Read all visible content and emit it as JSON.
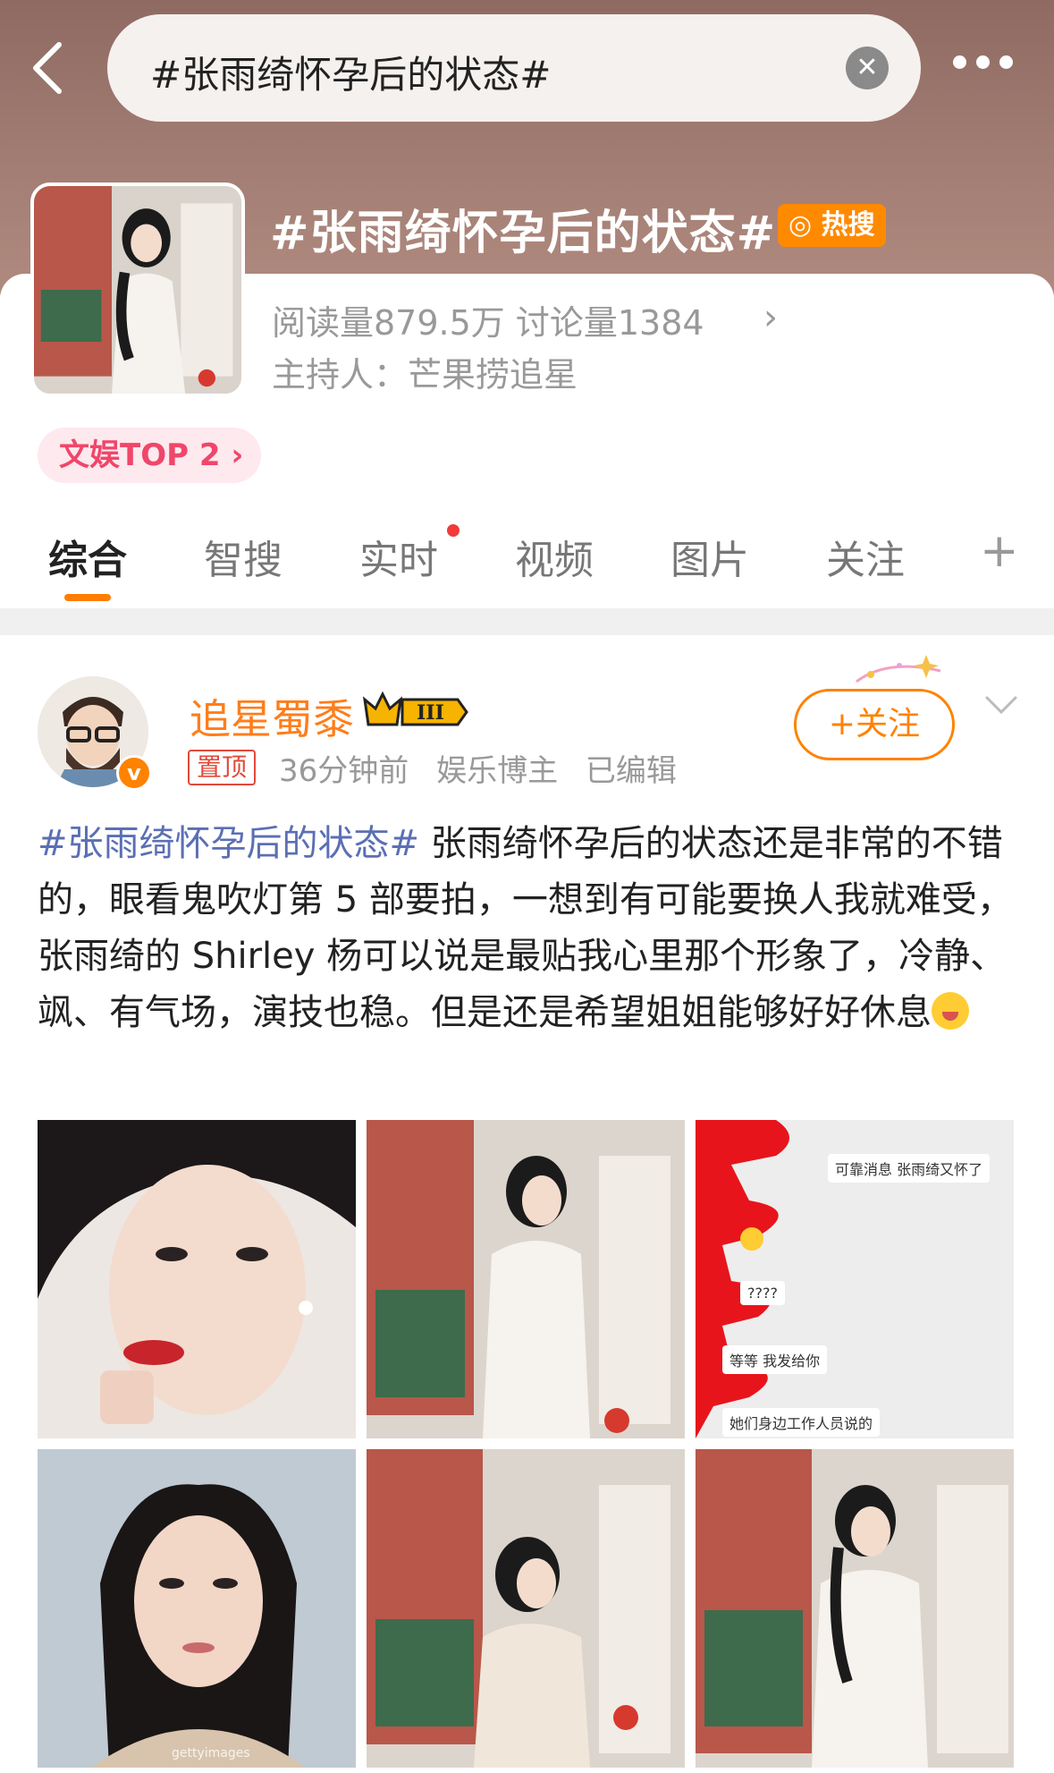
{
  "search": {
    "query": "#张雨绮怀孕后的状态#"
  },
  "topic": {
    "title": "#张雨绮怀孕后的状态#",
    "hot_label": "热搜",
    "stats": "阅读量879.5万  讨论量1384",
    "host": "主持人：芒果捞追星",
    "rank": "文娱TOP 2"
  },
  "tabs": [
    "综合",
    "智搜",
    "实时",
    "视频",
    "图片",
    "关注"
  ],
  "post": {
    "author": "追星蜀黍",
    "pinned": "置顶",
    "time": "36分钟前",
    "role": "娱乐博主",
    "edited": "已编辑",
    "follow_label": "+关注",
    "hashtag": "#张雨绮怀孕后的状态#",
    "body": " 张雨绮怀孕后的状态还是非常的不错的，眼看鬼吹灯第 5 部要拍，一想到有可能要换人我就难受，张雨绮的 Shirley 杨可以说是最贴我心里那个形象了，冷静、飒、有气场，演技也稳。但是还是希望姐姐能够好好休息"
  },
  "images": {
    "chat_lines": [
      "可靠消息 张雨绮又怀了",
      "????",
      "等等 我发给你",
      "她们身边工作人员说的"
    ],
    "watermark": "gettyimages"
  },
  "colors": {
    "accent_orange": "#ff8200",
    "hashtag_blue": "#5b6fb4",
    "rank_pink": "#f0466a"
  }
}
